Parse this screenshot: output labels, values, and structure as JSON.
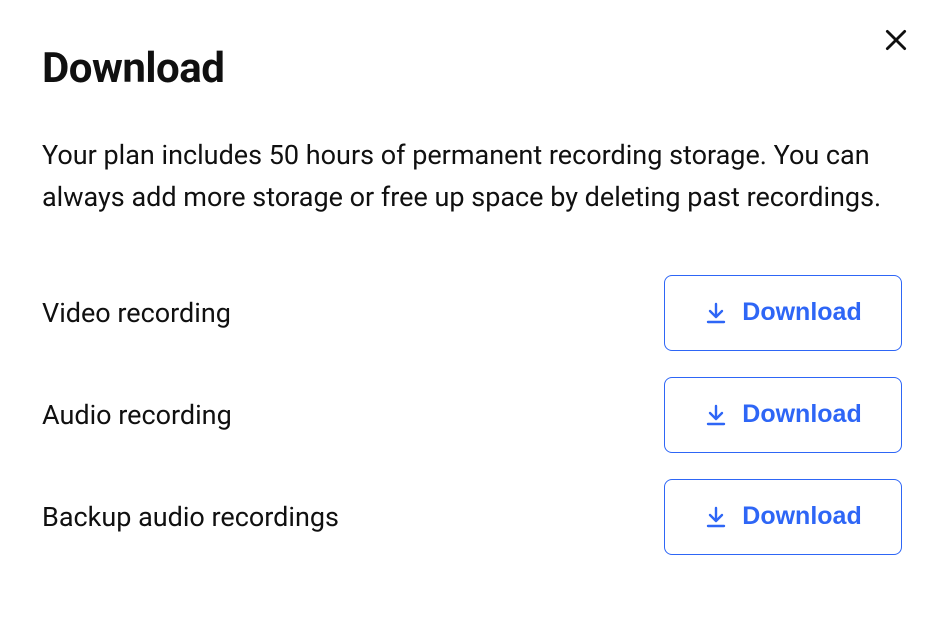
{
  "header": {
    "title": "Download",
    "description": "Your plan includes 50 hours of permanent recording storage. You can always add more storage or free up space by deleting past recordings."
  },
  "downloads": [
    {
      "label": "Video recording",
      "button": "Download"
    },
    {
      "label": "Audio recording",
      "button": "Download"
    },
    {
      "label": "Backup audio recordings",
      "button": "Download"
    }
  ]
}
